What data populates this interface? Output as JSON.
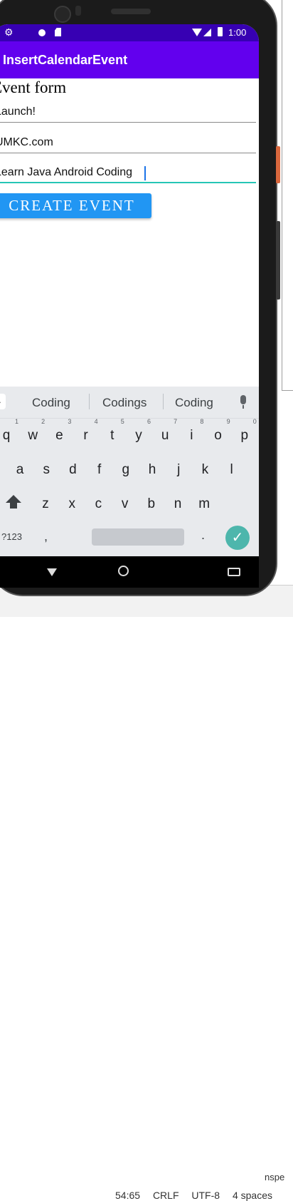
{
  "ide": {
    "path_fragment": "nspe",
    "status": [
      "54:65",
      "CRLF",
      "UTF-8",
      "4 spaces"
    ]
  },
  "statusbar": {
    "time": "1:00"
  },
  "app": {
    "title": "InsertCalendarEvent"
  },
  "form": {
    "heading": "Event form",
    "title_value": "Launch!",
    "location_value": "UMKC.com",
    "description_value": "Learn Java Android Coding",
    "button_label": "CREATE EVENT"
  },
  "keyboard": {
    "suggestions": [
      "Coding",
      "Codings",
      "Coding"
    ],
    "row1": [
      {
        "k": "q",
        "n": "1"
      },
      {
        "k": "w",
        "n": "2"
      },
      {
        "k": "e",
        "n": "3"
      },
      {
        "k": "r",
        "n": "4"
      },
      {
        "k": "t",
        "n": "5"
      },
      {
        "k": "y",
        "n": "6"
      },
      {
        "k": "u",
        "n": "7"
      },
      {
        "k": "i",
        "n": "8"
      },
      {
        "k": "o",
        "n": "9"
      },
      {
        "k": "p",
        "n": "0"
      }
    ],
    "row2": [
      "a",
      "s",
      "d",
      "f",
      "g",
      "h",
      "j",
      "k",
      "l"
    ],
    "row3": [
      "z",
      "x",
      "c",
      "v",
      "b",
      "n",
      "m"
    ],
    "symbols_label": "?123",
    "comma": ",",
    "period": ".",
    "enter": "✓"
  },
  "icons": [
    "settings-icon",
    "wifi-icon",
    "signal-icon",
    "battery-icon",
    "mic-icon",
    "shift-icon",
    "back-icon",
    "home-icon",
    "keyboard-icon"
  ],
  "colors": {
    "status_bar": "#3700b3",
    "app_bar": "#6200ee",
    "button": "#2196f3",
    "focus_line": "#26c6b6",
    "enter_key": "#4db6ac"
  }
}
